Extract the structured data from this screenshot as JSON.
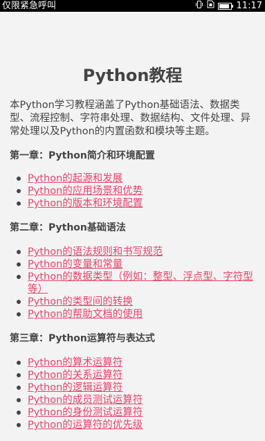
{
  "status_bar": {
    "carrier": "仅限紧急呼叫",
    "vibrate_icon": "vibrate-icon",
    "sim_icon": "sim-card-icon",
    "battery_icon": "battery-icon",
    "battery_level": 0.8,
    "time": "11:17"
  },
  "page": {
    "title": "Python教程",
    "intro": "本Python学习教程涵盖了Python基础语法、数据类型、流程控制、字符串处理、数据结构、文件处理、异常处理以及Python的内置函数和模块等主题。"
  },
  "chapters": [
    {
      "title": "第一章：Python简介和环境配置",
      "items": [
        "Python的起源和发展",
        "Python的应用场景和优势",
        "Python的版本和环境配置"
      ]
    },
    {
      "title": "第二章：Python基础语法",
      "items": [
        "Python的语法规则和书写规范",
        "Python的变量和常量",
        "Python的数据类型（例如：整型、浮点型、字符型等）",
        "Python的类型间的转换",
        "Python的帮助文档的使用"
      ]
    },
    {
      "title": "第三章：Python运算符与表达式",
      "items": [
        "Python的算术运算符",
        "Python的关系运算符",
        "Python的逻辑运算符",
        "Python的成员测试运算符",
        "Python的身份测试运算符",
        "Python的运算符的优先级"
      ]
    }
  ]
}
